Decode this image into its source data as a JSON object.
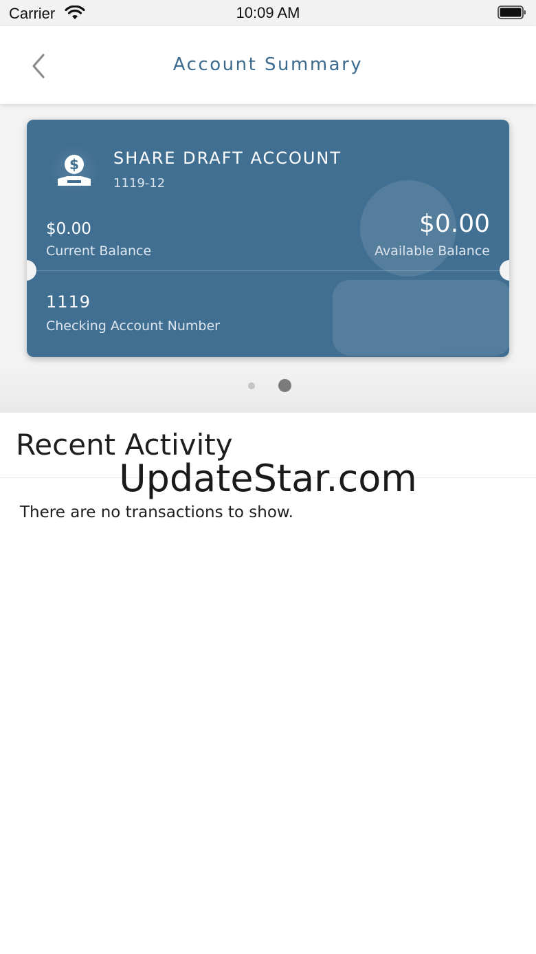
{
  "status_bar": {
    "carrier": "Carrier",
    "time": "10:09 AM"
  },
  "nav": {
    "title": "Account Summary",
    "back_icon": "chevron-left-icon"
  },
  "account_card": {
    "icon": "money-hand-icon",
    "name": "SHARE DRAFT ACCOUNT",
    "id": "1119-12",
    "current_balance": "$0.00",
    "current_balance_label": "Current Balance",
    "available_balance": "$0.00",
    "available_balance_label": "Available Balance",
    "account_number": "1119",
    "account_number_label": "Checking Account Number",
    "background_color": "#416f92"
  },
  "pagination": {
    "total": 2,
    "active_index": 1
  },
  "recent_activity": {
    "title": "Recent Activity",
    "empty_message": "There are no transactions to show."
  },
  "watermark": "UpdateStar.com",
  "colors": {
    "accent": "#3d6b8e",
    "card": "#416f92"
  }
}
